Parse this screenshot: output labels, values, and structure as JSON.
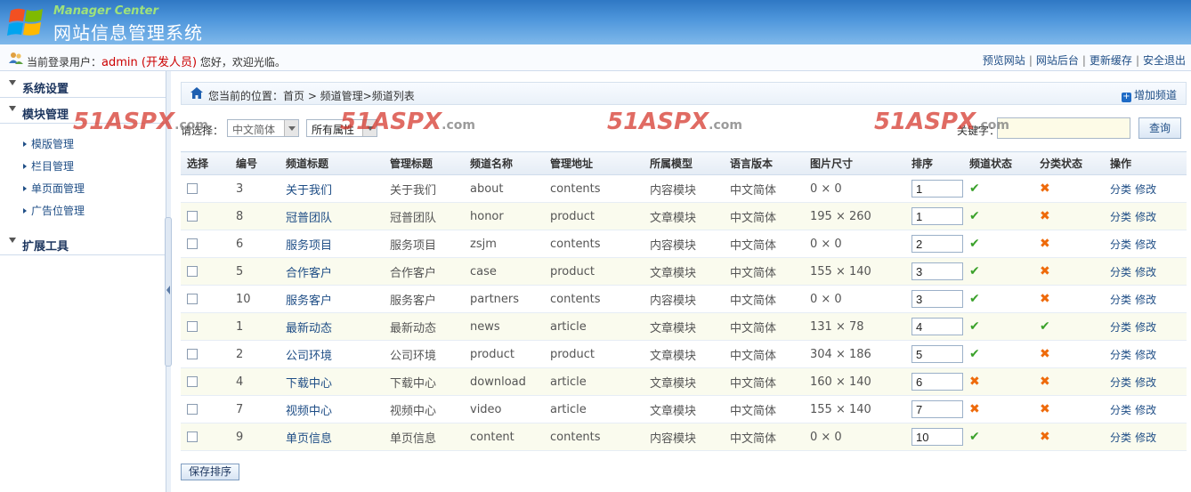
{
  "header": {
    "subtitle": "Manager Center",
    "title": "网站信息管理系统"
  },
  "topbar": {
    "login_prefix": "当前登录用户：",
    "user": "admin (开发人员)",
    "login_suffix": " 您好，欢迎光临。",
    "links": [
      "预览网站",
      "网站后台",
      "更新缓存",
      "安全退出"
    ]
  },
  "sidebar": {
    "sections": [
      "系统设置",
      "模块管理",
      "扩展工具"
    ],
    "items": [
      "模版管理",
      "栏目管理",
      "单页面管理",
      "广告位管理"
    ]
  },
  "breadcrumb": {
    "text": "您当前的位置：首页 > 频道管理>频道列表",
    "add_label": "增加频道"
  },
  "filter": {
    "label": "请选择：",
    "language": "中文简体",
    "attribute": "所有属性",
    "keyword_label": "关键字：",
    "keyword_value": "",
    "query_label": "查询"
  },
  "watermark": {
    "brand": "51ASPX",
    "suffix": ".com"
  },
  "table": {
    "headers": [
      "选择",
      "编号",
      "频道标题",
      "管理标题",
      "频道名称",
      "管理地址",
      "所属模型",
      "语言版本",
      "图片尺寸",
      "排序",
      "频道状态",
      "分类状态",
      "操作"
    ],
    "rows": [
      {
        "id": "3",
        "title": "关于我们",
        "admin_title": "关于我们",
        "name": "about",
        "path": "contents",
        "model": "内容模块",
        "lang": "中文简体",
        "size": "0 × 0",
        "sort": "1",
        "channel_ok": true,
        "class_ok": false
      },
      {
        "id": "8",
        "title": "冠普团队",
        "admin_title": "冠普团队",
        "name": "honor",
        "path": "product",
        "model": "文章模块",
        "lang": "中文简体",
        "size": "195 × 260",
        "sort": "1",
        "channel_ok": true,
        "class_ok": false
      },
      {
        "id": "6",
        "title": "服务项目",
        "admin_title": "服务项目",
        "name": "zsjm",
        "path": "contents",
        "model": "内容模块",
        "lang": "中文简体",
        "size": "0 × 0",
        "sort": "2",
        "channel_ok": true,
        "class_ok": false
      },
      {
        "id": "5",
        "title": "合作客户",
        "admin_title": "合作客户",
        "name": "case",
        "path": "product",
        "model": "文章模块",
        "lang": "中文简体",
        "size": "155 × 140",
        "sort": "3",
        "channel_ok": true,
        "class_ok": false
      },
      {
        "id": "10",
        "title": "服务客户",
        "admin_title": "服务客户",
        "name": "partners",
        "path": "contents",
        "model": "内容模块",
        "lang": "中文简体",
        "size": "0 × 0",
        "sort": "3",
        "channel_ok": true,
        "class_ok": false
      },
      {
        "id": "1",
        "title": "最新动态",
        "admin_title": "最新动态",
        "name": "news",
        "path": "article",
        "model": "文章模块",
        "lang": "中文简体",
        "size": "131 × 78",
        "sort": "4",
        "channel_ok": true,
        "class_ok": true
      },
      {
        "id": "2",
        "title": "公司环境",
        "admin_title": "公司环境",
        "name": "product",
        "path": "product",
        "model": "文章模块",
        "lang": "中文简体",
        "size": "304 × 186",
        "sort": "5",
        "channel_ok": true,
        "class_ok": false
      },
      {
        "id": "4",
        "title": "下载中心",
        "admin_title": "下载中心",
        "name": "download",
        "path": "article",
        "model": "文章模块",
        "lang": "中文简体",
        "size": "160 × 140",
        "sort": "6",
        "channel_ok": false,
        "class_ok": false
      },
      {
        "id": "7",
        "title": "视频中心",
        "admin_title": "视频中心",
        "name": "video",
        "path": "article",
        "model": "文章模块",
        "lang": "中文简体",
        "size": "155 × 140",
        "sort": "7",
        "channel_ok": false,
        "class_ok": false
      },
      {
        "id": "9",
        "title": "单页信息",
        "admin_title": "单页信息",
        "name": "content",
        "path": "contents",
        "model": "内容模块",
        "lang": "中文简体",
        "size": "0 × 0",
        "sort": "10",
        "channel_ok": true,
        "class_ok": false
      }
    ],
    "op_class": "分类",
    "op_edit": "修改"
  },
  "save_label": "保存排序",
  "colors": {
    "ok": "#3aa12a",
    "no": "#ee6a0a",
    "link": "#1f4e86",
    "header": "#2f78c4"
  }
}
